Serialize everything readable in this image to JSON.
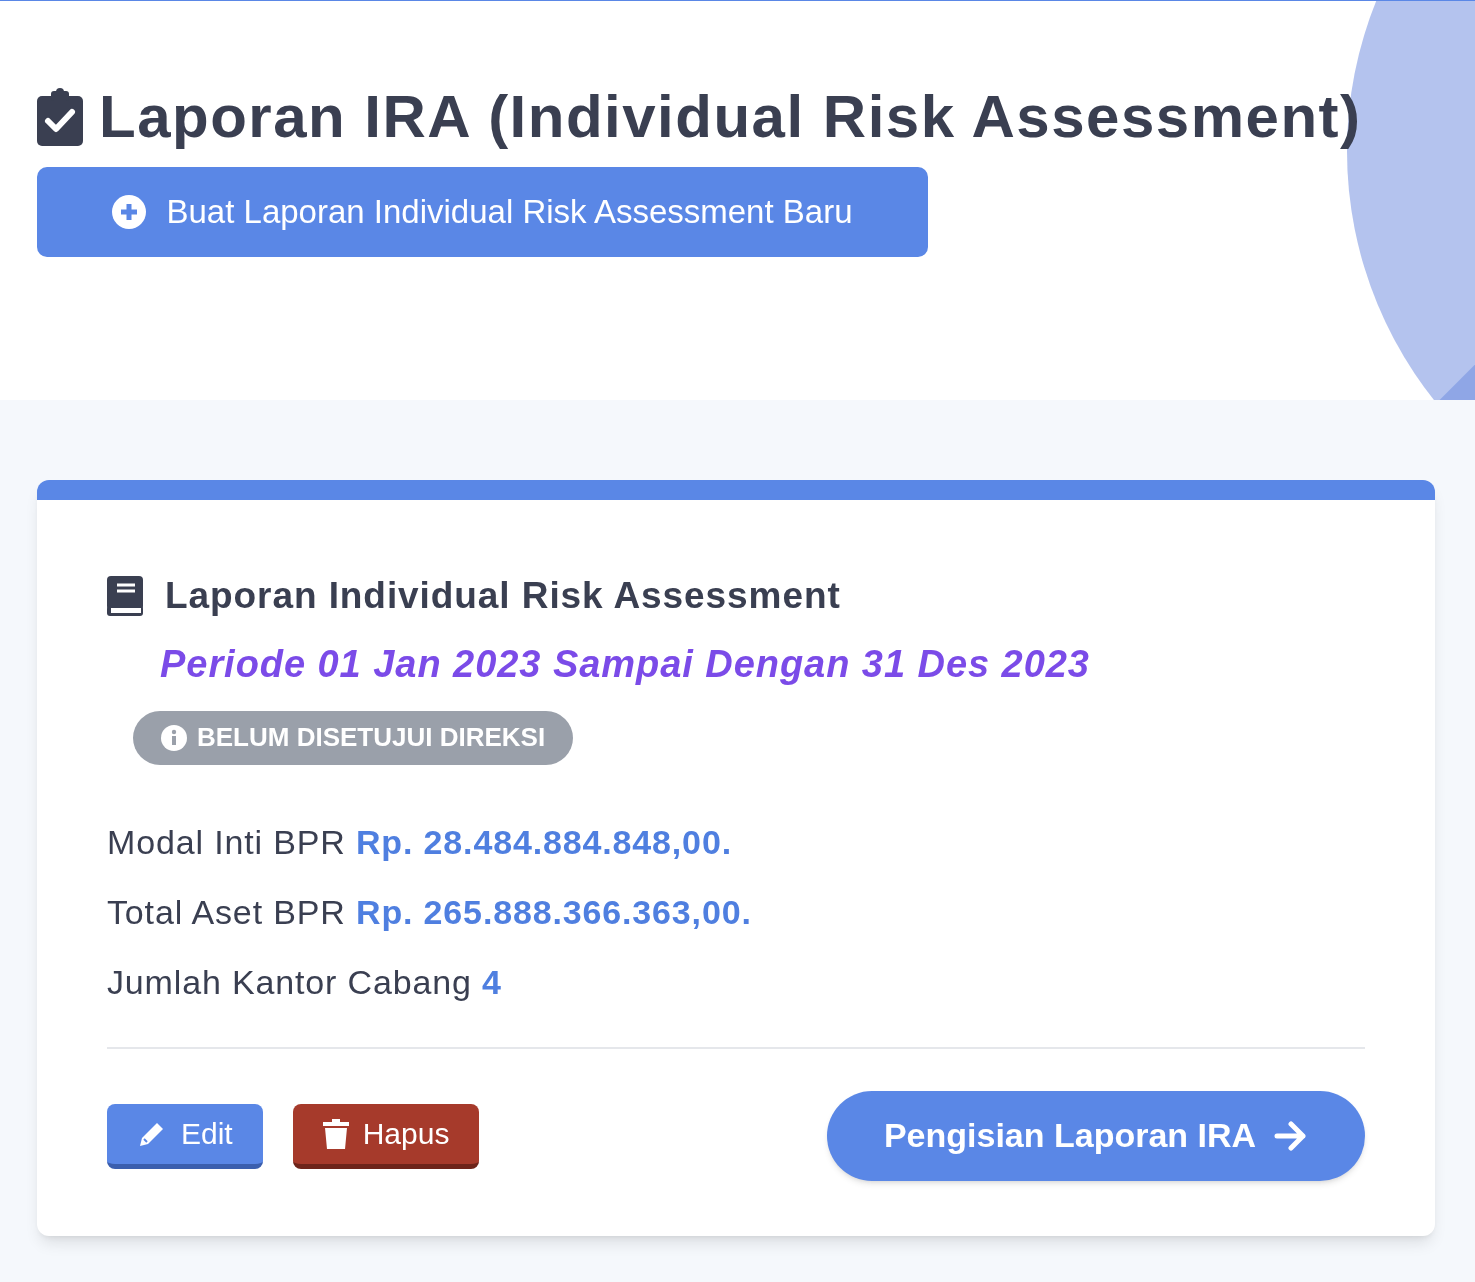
{
  "page_title": "Laporan IRA (Individual Risk Assessment)",
  "create_button": "Buat Laporan Individual Risk Assessment Baru",
  "card": {
    "heading": "Laporan Individual Risk Assessment",
    "period": "Periode 01 Jan 2023 Sampai Dengan 31 Des 2023",
    "status_badge": "BELUM DISETUJUI DIREKSI",
    "info_rows": [
      "Modal Inti BPR **Rp. 28.484.884.848,00.**",
      "Total Aset BPR **Rp. 265.888.366.363,00.**",
      "Jumlah Kantor Cabang **4**"
    ],
    "actions": [
      {
        "kind": "edit",
        "label": "Edit"
      },
      {
        "kind": "delete",
        "label": "Hapus"
      },
      {
        "kind": "next",
        "label": "Pengisian Laporan IRA"
      }
    ]
  }
}
